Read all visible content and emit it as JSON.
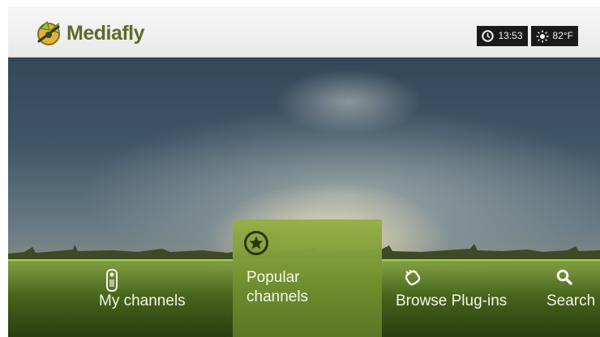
{
  "app": {
    "name": "Mediafly"
  },
  "header": {
    "clock": {
      "icon": "clock-icon",
      "time": "13:53"
    },
    "weather": {
      "icon": "sun-icon",
      "temperature": "82°F"
    }
  },
  "menu": {
    "selected": "Popular channels",
    "items": [
      {
        "label": "My channels",
        "icon": "remote-icon"
      },
      {
        "label_line1": "Popular",
        "label_line2": "channels",
        "icon": "star-circle-icon"
      },
      {
        "label": "Browse Plug-ins",
        "icon": "plug-icon"
      },
      {
        "label": "Search",
        "icon": "search-icon"
      }
    ]
  },
  "colors": {
    "accent": "#a8d44a",
    "menu_bg": "#4a6a1e",
    "selected_bg": "#8aa83e"
  }
}
